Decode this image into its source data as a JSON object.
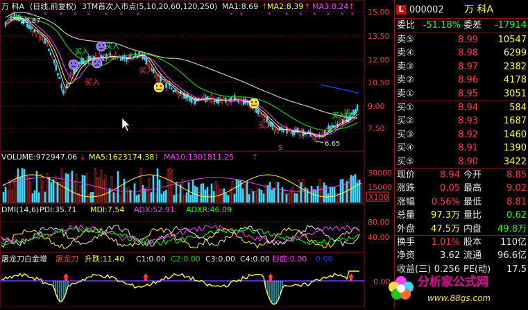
{
  "chart_header": {
    "stock_name": "万 科A",
    "period": "(日线,前复权)",
    "indicator": "3TM首次入市点(5,10,20,60,120,250)",
    "ma1": "MA1:8.69",
    "ma2": "MA2:8.39",
    "ma3": "MA3:8.24"
  },
  "price_axis": [
    "15.00",
    "13.50",
    "12.00",
    "10.50",
    "9.00",
    "7.50"
  ],
  "annotations": {
    "high": "13.87",
    "low": "6.65",
    "buy_text": "买入",
    "s_mark": "S"
  },
  "volume_header": {
    "volume": "VOLUME:972947.06",
    "ma5": "MA5:1623174.38",
    "ma10": "MA10:1301811.25"
  },
  "volume_axis": [
    "30000",
    "15000",
    "X100"
  ],
  "dmi_header": {
    "title": "DMI(14,6)",
    "pdi": "PDI:35.71",
    "mdi": "MDI:7.54",
    "adx": "ADX:52.91",
    "adxr": "ADXR:46.09"
  },
  "dmi_axis": [
    "80.00",
    "40.00"
  ],
  "tlj_header": {
    "title": "屠龙刀白金增",
    "tlj": "屠龙刀",
    "rise": "升跌:11.40",
    "c1": "C1:0.00",
    "c2": "C2:0.00",
    "c3": "C3:0.00",
    "c4": "C4:0.00",
    "bottom": "抄底:0.00",
    "extra": "0.00"
  },
  "tlj_axis": [
    "0.00"
  ],
  "quote": {
    "badge": "L",
    "code": "000002",
    "name": "万  科A",
    "weibi_label": "委比",
    "weibi": "-51.18%",
    "weicha_label": "委差",
    "weicha": "-17914",
    "asks": [
      {
        "label": "卖⑤",
        "price": "8.99",
        "vol": "10547"
      },
      {
        "label": "卖④",
        "price": "8.98",
        "vol": "6299"
      },
      {
        "label": "卖③",
        "price": "8.97",
        "vol": "2382"
      },
      {
        "label": "卖②",
        "price": "8.96",
        "vol": "4178"
      },
      {
        "label": "卖①",
        "price": "8.95",
        "vol": "3051"
      }
    ],
    "bids": [
      {
        "label": "买①",
        "price": "8.94",
        "vol": "584"
      },
      {
        "label": "买②",
        "price": "8.93",
        "vol": "1687"
      },
      {
        "label": "买③",
        "price": "8.92",
        "vol": "1460"
      },
      {
        "label": "买④",
        "price": "8.91",
        "vol": "1390"
      },
      {
        "label": "买⑤",
        "price": "8.90",
        "vol": "3422"
      }
    ],
    "stats": [
      {
        "l1": "现价",
        "v1": "8.94",
        "l2": "今开",
        "v2": "8.85"
      },
      {
        "l1": "涨跌",
        "v1": "0.05",
        "l2": "最高",
        "v2": "9.02"
      },
      {
        "l1": "涨幅",
        "v1": "0.56%",
        "l2": "最低",
        "v2": "8.81"
      },
      {
        "l1": "总量",
        "v1": "97.3万",
        "l2": "量比",
        "v2": "0.62"
      },
      {
        "l1": "外盘",
        "v1": "47.5万",
        "l2": "内盘",
        "v2": "49.8万"
      }
    ],
    "stats2": [
      {
        "l1": "换手",
        "v1": "1.01%",
        "l2": "股本",
        "v2": "110亿"
      },
      {
        "l1": "净资",
        "v1": "3.62",
        "l2": "流通",
        "v2": "96.6亿"
      },
      {
        "l1": "收益(三)",
        "v1": "0.256",
        "l2": "PE(动)",
        "v2": "17.5"
      }
    ]
  },
  "watermark": {
    "name": "分析家公式网",
    "url": "www.88gs.com"
  },
  "colors": {
    "up": "#ff3b3b",
    "down": "#19ff19",
    "ma_white": "#e8e8e8",
    "ma_yellow": "#ffff3a",
    "ma_magenta": "#ff3bff",
    "ma_green": "#19c819",
    "ma_blue": "#2a3aff"
  }
}
